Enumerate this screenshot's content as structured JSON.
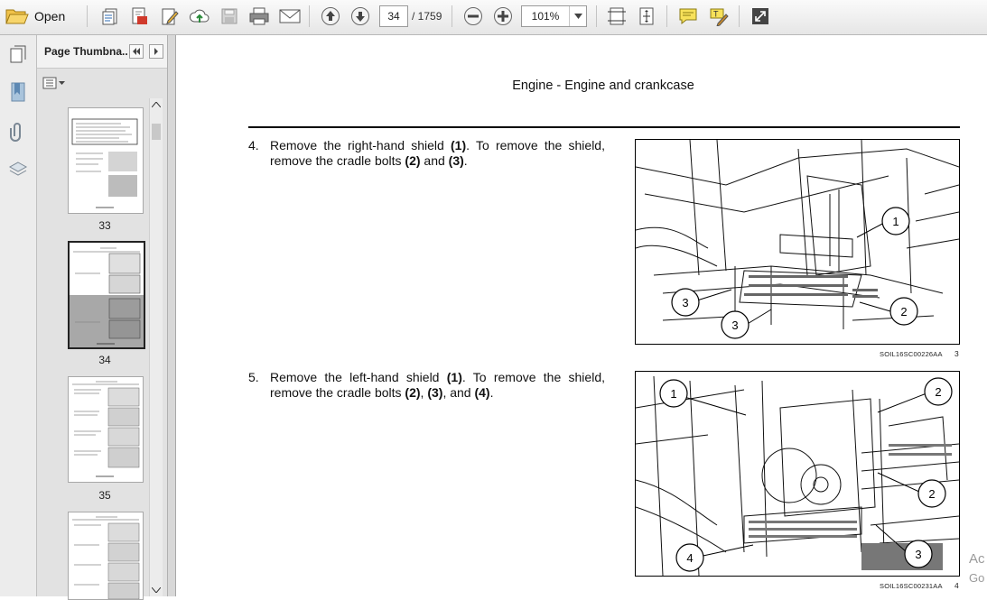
{
  "toolbar": {
    "open_label": "Open",
    "page_current": "34",
    "page_total": "/ 1759",
    "zoom": "101%"
  },
  "side_panel": {
    "title": "Page Thumbna...",
    "thumbnails": [
      {
        "label": "33",
        "selected": false
      },
      {
        "label": "34",
        "selected": true
      },
      {
        "label": "35",
        "selected": false
      },
      {
        "label": "",
        "selected": false
      }
    ]
  },
  "document": {
    "title": "Engine - Engine and crankcase",
    "steps": [
      {
        "number": "4.",
        "text_parts": [
          "Remove the right-hand shield ",
          "(1)",
          ".  To remove the shield, remove the cradle bolts ",
          "(2)",
          " and ",
          "(3)",
          "."
        ],
        "figure_code": "SOIL16SC00226AA",
        "figure_number": "3",
        "callouts": [
          "1",
          "2",
          "3",
          "3"
        ]
      },
      {
        "number": "5.",
        "text_parts": [
          "Remove the left-hand shield ",
          "(1)",
          ". To remove the shield, remove the cradle bolts ",
          "(2)",
          ", ",
          "(3)",
          ", and ",
          "(4)",
          "."
        ],
        "figure_code": "SOIL16SC00231AA",
        "figure_number": "4",
        "callouts": [
          "1",
          "2",
          "2",
          "3",
          "4"
        ]
      }
    ],
    "watermark": [
      "Ac",
      "Go"
    ]
  },
  "icons": [
    "open-folder-icon",
    "create-pdf-icon",
    "export-pdf-icon",
    "edit-pdf-icon",
    "upload-cloud-icon",
    "save-icon",
    "print-icon",
    "email-icon",
    "previous-page-icon",
    "next-page-icon",
    "zoom-out-icon",
    "zoom-in-icon",
    "fit-width-icon",
    "fit-page-icon",
    "comment-icon",
    "highlight-icon",
    "full-screen-icon"
  ]
}
